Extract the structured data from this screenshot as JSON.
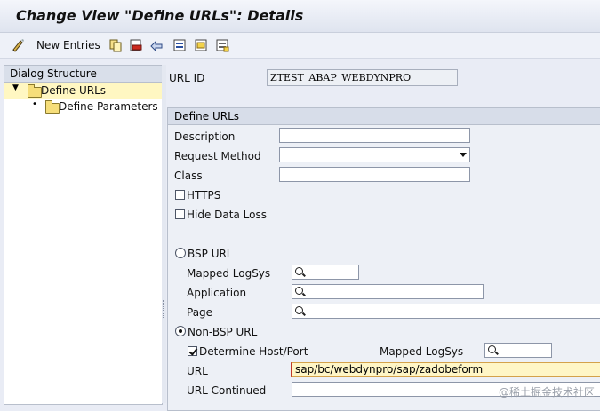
{
  "window": {
    "title": "Change View \"Define URLs\": Details"
  },
  "toolbar": {
    "new_entries_label": "New Entries"
  },
  "dialog_structure": {
    "title": "Dialog Structure",
    "items": [
      {
        "label": "Define URLs"
      },
      {
        "label": "Define Parameters"
      }
    ]
  },
  "header_fields": {
    "url_id_label": "URL ID",
    "url_id_value": "ZTEST_ABAP_WEBDYNPRO"
  },
  "define_urls": {
    "title": "Define URLs",
    "description_label": "Description",
    "description_value": "",
    "request_method_label": "Request Method",
    "request_method_value": "",
    "class_label": "Class",
    "class_value": "",
    "https_label": "HTTPS",
    "https_checked": false,
    "hide_data_loss_label": "Hide Data Loss",
    "hide_data_loss_checked": false,
    "bsp_url_label": "BSP URL",
    "bsp_selected": false,
    "mapped_logsys_label": "Mapped LogSys",
    "mapped_logsys_value": "",
    "application_label": "Application",
    "application_value": "",
    "page_label": "Page",
    "page_value": "",
    "non_bsp_url_label": "Non-BSP  URL",
    "non_bsp_selected": true,
    "determine_host_label": "Determine Host/Port",
    "determine_host_checked": true,
    "non_bsp_mapped_logsys_label": "Mapped LogSys",
    "non_bsp_mapped_logsys_value": "",
    "url_label": "URL",
    "url_value": "sap/bc/webdynpro/sap/zadobeform",
    "url_continued_label": "URL Continued",
    "url_continued_value": ""
  },
  "watermark": "@稀土掘金技术社区"
}
